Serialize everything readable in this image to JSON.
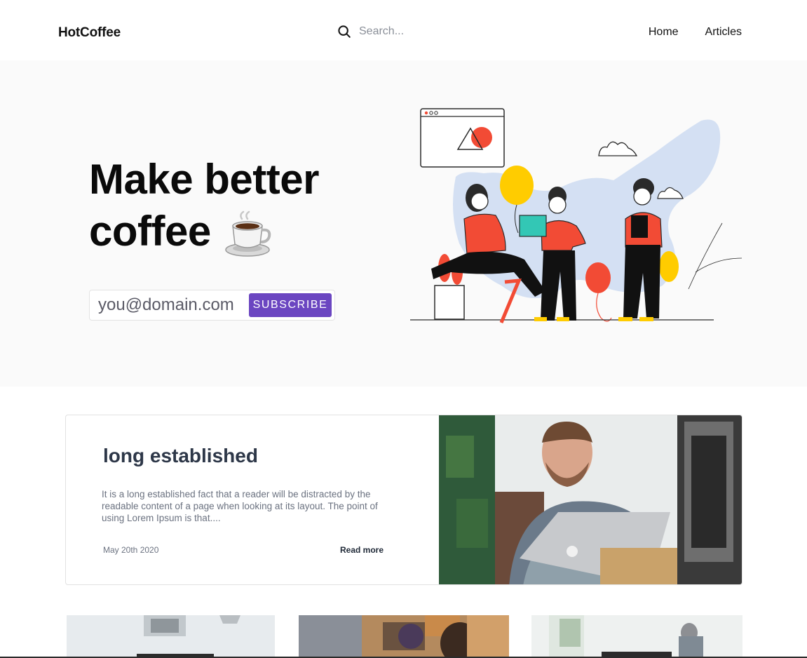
{
  "header": {
    "logo": "HotCoffee",
    "search_placeholder": "Search...",
    "nav": [
      {
        "label": "Home"
      },
      {
        "label": "Articles"
      }
    ]
  },
  "hero": {
    "title_line1": "Make better",
    "title_line2": "coffee",
    "email_placeholder": "you@domain.com",
    "subscribe_label": "SUBSCRIBE"
  },
  "featured": {
    "title": "long established",
    "excerpt": "It is a long established fact that a reader will be distracted by the readable content of a page when looking at its layout. The point of using Lorem Ipsum is that....",
    "date": "May 20th 2020",
    "read_more": "Read more"
  },
  "colors": {
    "accent": "#6b46c1",
    "hero_bg": "#fafafa",
    "title_dark": "#2d3748",
    "muted_text": "#6b7280"
  },
  "icons": [
    "search-icon",
    "coffee-cup-icon"
  ]
}
